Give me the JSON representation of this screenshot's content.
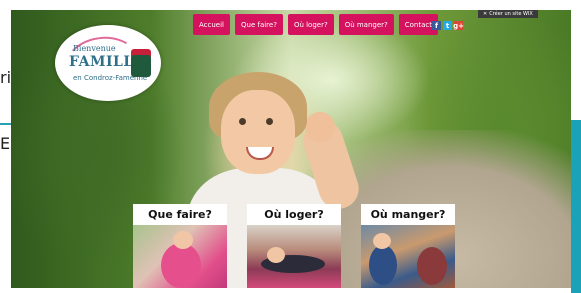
{
  "page": {
    "edge_left_1": "ri",
    "edge_left_2": "Ec"
  },
  "nav": {
    "items": [
      {
        "label": "Accueil"
      },
      {
        "label": "Que faire?"
      },
      {
        "label": "Où loger?"
      },
      {
        "label": "Où manger?"
      },
      {
        "label": "Contact"
      }
    ]
  },
  "logo": {
    "line1": "Bienvenue",
    "line2": "FAMILLE",
    "line3": "en Condroz-Famenne"
  },
  "social": {
    "facebook": "f",
    "twitter": "t",
    "google": "g+"
  },
  "close_tab": {
    "label": "Créer un site WIX"
  },
  "cards": [
    {
      "title": "Que faire?"
    },
    {
      "title": "Où loger?"
    },
    {
      "title": "Où manger?"
    }
  ],
  "colors": {
    "nav_button": "#d4125e",
    "accent_teal": "#1aa3b8",
    "logo_blue": "#2f6f89"
  }
}
